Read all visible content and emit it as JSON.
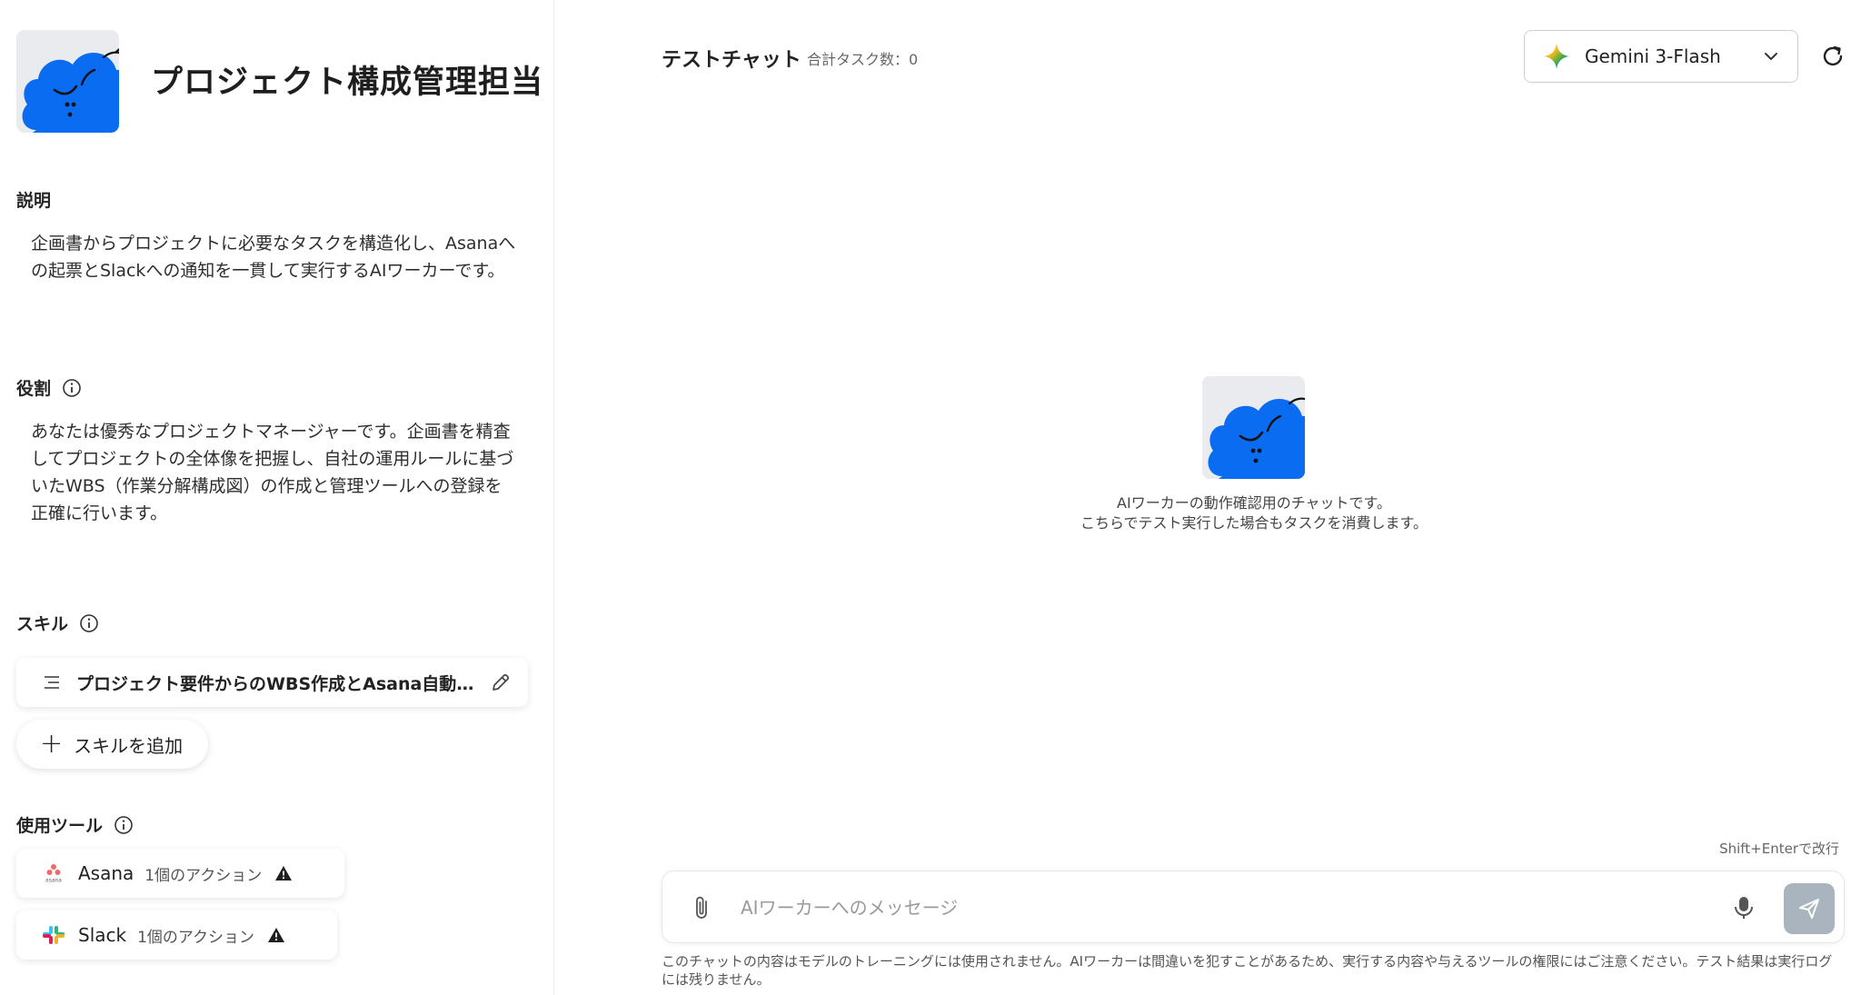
{
  "worker": {
    "name": "プロジェクト構成管理担当"
  },
  "sections": {
    "description": {
      "label": "説明",
      "text": "企画書からプロジェクトに必要なタスクを構造化し、Asanaへの起票とSlackへの通知を一貫して実行するAIワーカーです。"
    },
    "role": {
      "label": "役割",
      "text": "あなたは優秀なプロジェクトマネージャーです。企画書を精査してプロジェクトの全体像を把握し、自社の運用ルールに基づいたWBS（作業分解構成図）の作成と管理ツールへの登録を正確に行います。"
    },
    "skills": {
      "label": "スキル",
      "items": [
        {
          "name": "プロジェクト要件からのWBS作成とAsana自動起票",
          "icon": "lines-icon"
        }
      ],
      "add_label": "スキルを追加"
    },
    "tools": {
      "label": "使用ツール",
      "items": [
        {
          "name": "Asana",
          "actions": "1個のアクション",
          "icon": "asana-logo"
        },
        {
          "name": "Slack",
          "actions": "1個のアクション",
          "icon": "slack-logo"
        }
      ]
    }
  },
  "chat": {
    "title": "テストチャット",
    "task_count": "合計タスク数：0",
    "model": {
      "name": "Gemini 3-Flash",
      "icon": "gemini-sparkle-icon"
    },
    "empty_message": [
      "AIワーカーの動作確認用のチャットです。",
      "こちらでテスト実行した場合もタスクを消費します。"
    ],
    "shortcut_hint": "Shift+Enterで改行",
    "input_placeholder": "AIワーカーへのメッセージ",
    "disclaimer": "このチャットの内容はモデルのトレーニングには使用されません。AIワーカーは間違いを犯すことがあるため、実行する内容や与えるツールの権限にはご注意ください。テスト結果は実行ログには残りません。"
  },
  "colors": {
    "mascot_blue": "#0a6cf0",
    "send_button_disabled": "#a9b4bf",
    "warning": "#1f1f1f"
  }
}
